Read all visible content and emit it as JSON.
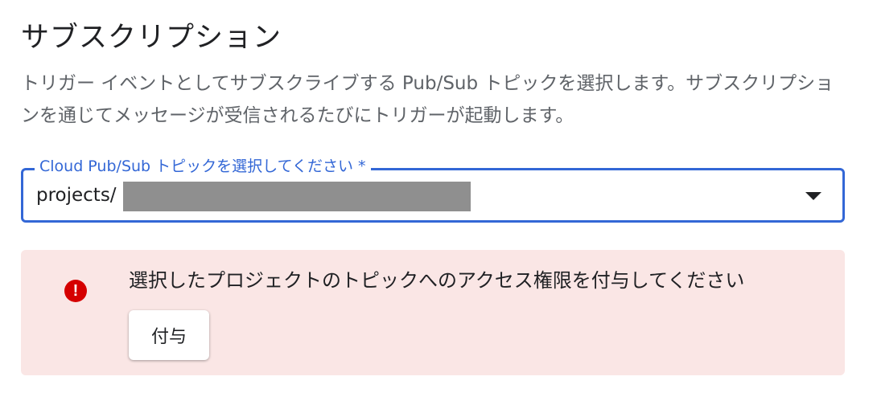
{
  "section": {
    "title": "サブスクリプション",
    "description": "トリガー イベントとしてサブスクライブする Pub/Sub トピックを選択します。サブスクリプションを通じてメッセージが受信されるたびにトリガーが起動します。"
  },
  "topic_field": {
    "label": "Cloud Pub/Sub トピックを選択してください *",
    "value": "projects/",
    "redacted": true,
    "dropdown_icon": "arrow-drop-down-icon",
    "accent_color": "#3367d6"
  },
  "alert": {
    "icon": "error-icon",
    "message": "選択したプロジェクトのトピックへのアクセス権限を付与してください",
    "button_label": "付与",
    "background_color": "#fae6e5",
    "icon_color": "#d50000"
  }
}
